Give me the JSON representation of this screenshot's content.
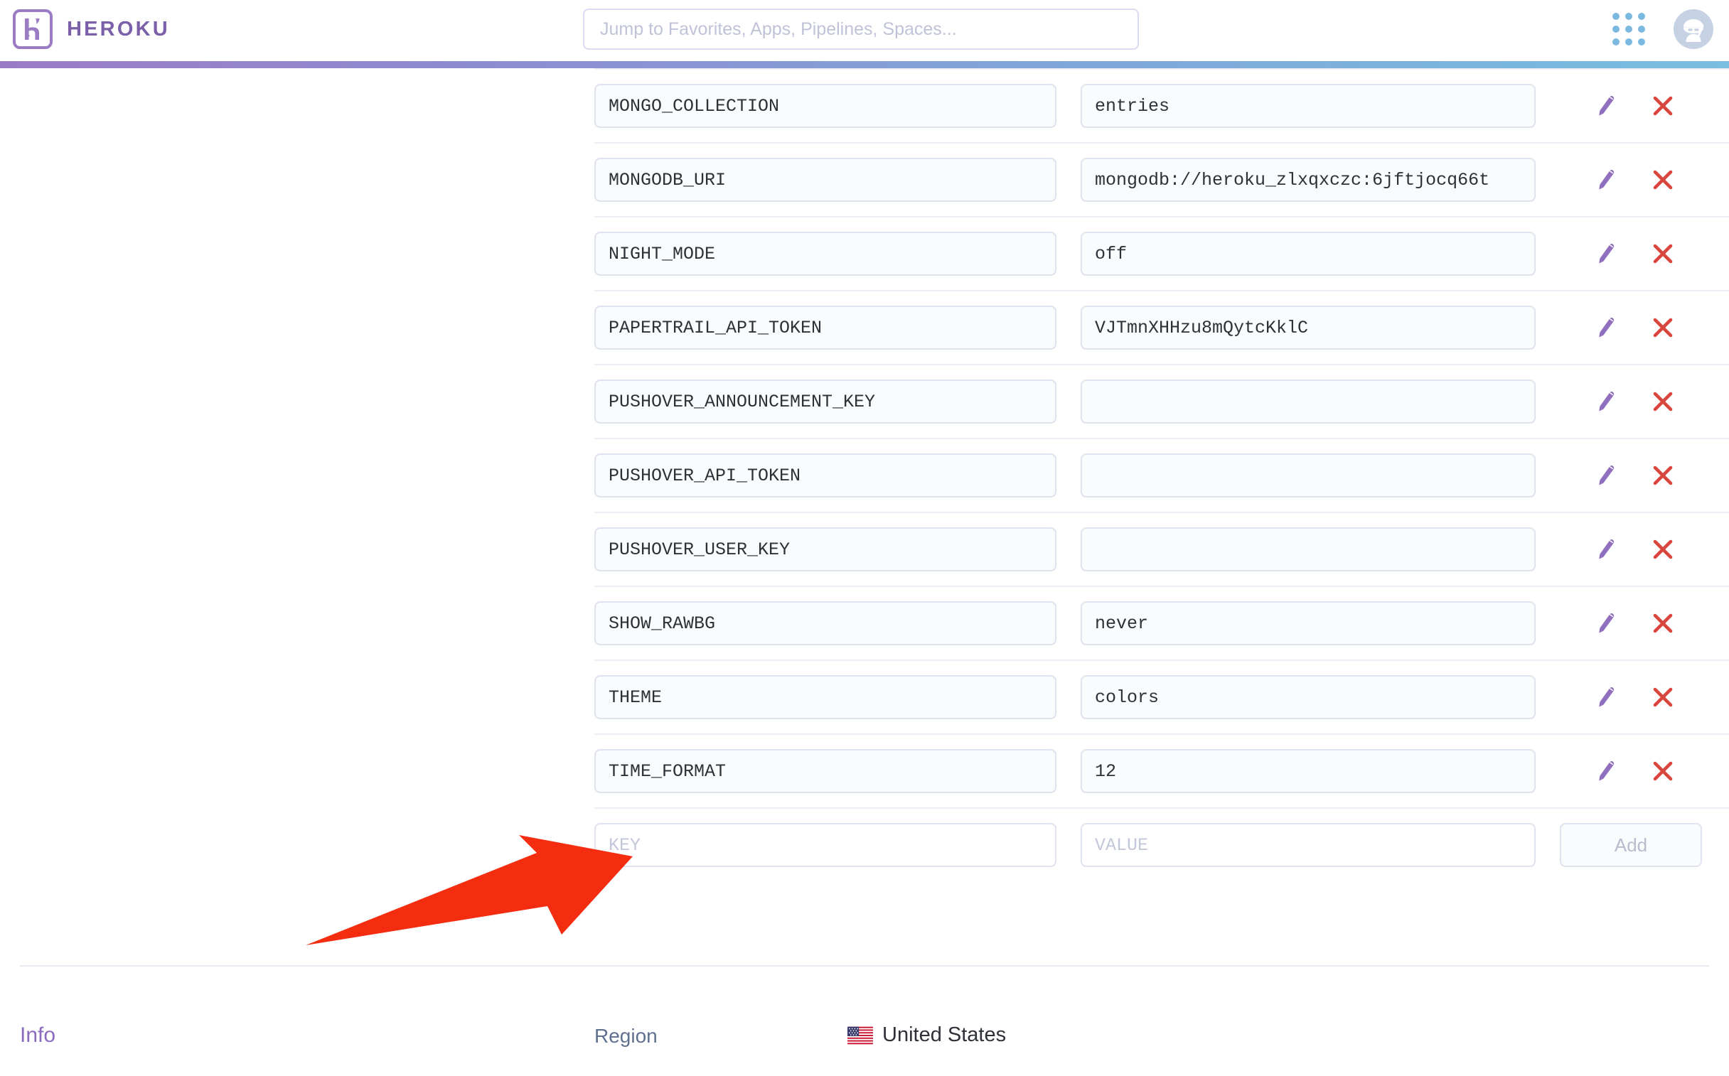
{
  "brand": {
    "name": "HEROKU",
    "logo_icon": "heroku-logo-icon",
    "accent_color": "#9b7cc4",
    "accent_gradient_end": "#79bde0"
  },
  "search": {
    "placeholder": "Jump to Favorites, Apps, Pipelines, Spaces...",
    "value": ""
  },
  "nav": {
    "apps_grid_icon": "apps-grid-icon",
    "avatar_icon": "ninja-avatar-icon"
  },
  "config_vars": {
    "key_placeholder": "KEY",
    "value_placeholder": "VALUE",
    "add_label": "Add",
    "edit_icon": "pencil-icon",
    "delete_icon": "close-x-icon",
    "rows": [
      {
        "key": "MONGO_COLLECTION",
        "value": "entries"
      },
      {
        "key": "MONGODB_URI",
        "value": "mongodb://heroku_zlxqxczc:6jftjocq66t"
      },
      {
        "key": "NIGHT_MODE",
        "value": "off"
      },
      {
        "key": "PAPERTRAIL_API_TOKEN",
        "value": "VJTmnXHHzu8mQytcKklC"
      },
      {
        "key": "PUSHOVER_ANNOUNCEMENT_KEY",
        "value": ""
      },
      {
        "key": "PUSHOVER_API_TOKEN",
        "value": ""
      },
      {
        "key": "PUSHOVER_USER_KEY",
        "value": ""
      },
      {
        "key": "SHOW_RAWBG",
        "value": "never"
      },
      {
        "key": "THEME",
        "value": "colors"
      },
      {
        "key": "TIME_FORMAT",
        "value": "12"
      }
    ]
  },
  "annotation": {
    "shape": "red-arrow-pointing-to-key-field",
    "color": "#f42c10"
  },
  "info": {
    "title": "Info",
    "region_label": "Region",
    "region_value": "United States",
    "region_flag_icon": "us-flag-icon"
  }
}
